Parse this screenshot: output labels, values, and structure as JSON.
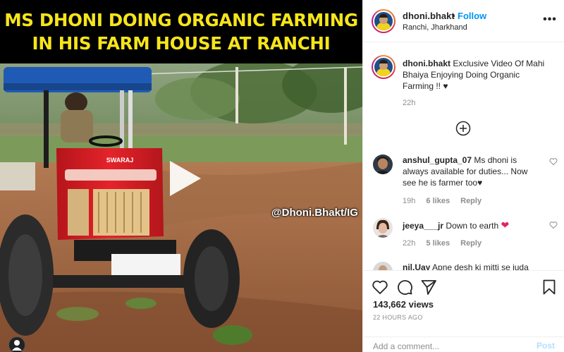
{
  "video": {
    "banner_line1": "MS DHONI DOING ORGANIC FARMING",
    "banner_line2": "IN HIS FARM HOUSE AT RANCHI",
    "watermark": "@Dhoni.Bhakt/IG",
    "tractor_badge": "SWARAJ",
    "play_icon": "play-icon"
  },
  "header": {
    "username": "dhoni.bhakt",
    "separator": "•",
    "follow_label": "Follow",
    "location": "Ranchi, Jharkhand",
    "more_icon": "more-options-icon",
    "more_label": "•••"
  },
  "caption": {
    "username": "dhoni.bhakt",
    "text": "Exclusive Video Of Mahi Bhaiya Enjoying Doing Organic Farming !! ",
    "heart": "♥",
    "time": "22h"
  },
  "load_more_icon": "plus-circle-icon",
  "comments": [
    {
      "username": "anshul_gupta_07",
      "text": "Ms dhoni is always available for duties... Now see he is farmer too",
      "emoji": "♥",
      "time": "19h",
      "likes": "6 likes",
      "reply": "Reply"
    },
    {
      "username": "jeeya___jr",
      "text": "Down to earth ",
      "emoji": "❤",
      "time": "22h",
      "likes": "5 likes",
      "reply": "Reply"
    },
    {
      "username": "nil.Uay",
      "text": "Apne desh ki mitti se juda"
    }
  ],
  "actions": {
    "icons": [
      "heart-icon",
      "comment-icon",
      "share-icon",
      "bookmark-icon"
    ],
    "views": "143,662 views",
    "time_ago": "22 HOURS AGO"
  },
  "comment_box": {
    "placeholder": "Add a comment...",
    "post_label": "Post"
  },
  "colors": {
    "banner_text": "#f6e51a",
    "follow": "#0095f6",
    "post_disabled": "#b2dffc",
    "muted": "#8e8e8e"
  }
}
